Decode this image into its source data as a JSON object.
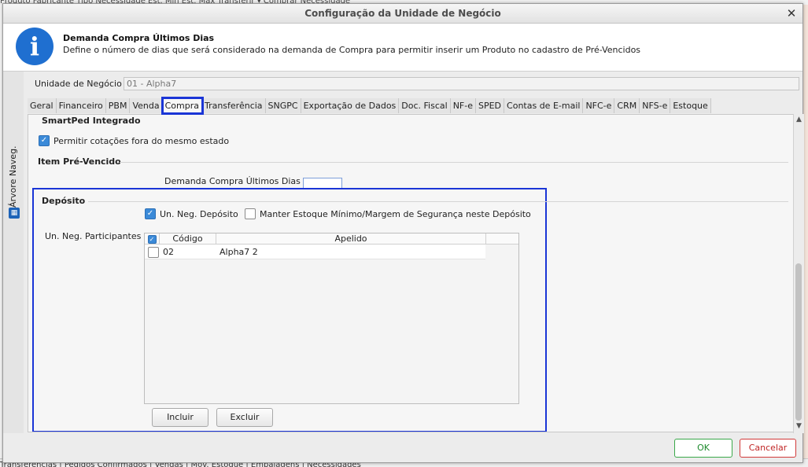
{
  "background": {
    "top_headers": "Produto            Fabricante           Tipo Necessidade            Est. Mín    Est. Máx    Transferir ▾    Comprar    Necessidade",
    "bottom_tabs": "Transferências | Pedidos Confirmados | Vendas | Mov. Estoque | Embalagens | Necessidades"
  },
  "dialog": {
    "title": "Configuração da Unidade de Negócio",
    "close_glyph": "✕"
  },
  "info": {
    "icon_glyph": "i",
    "title": "Demanda Compra Últimos Dias",
    "description": "Define o número de dias que será considerado na demanda de Compra para permitir inserir um Produto no cadastro de Pré-Vencidos"
  },
  "sidebar": {
    "label": "Árvore Naveg."
  },
  "unidade": {
    "label": "Unidade de Negócio",
    "value": "01 - Alpha7"
  },
  "tabs": [
    {
      "label": "Geral"
    },
    {
      "label": "Financeiro"
    },
    {
      "label": "PBM"
    },
    {
      "label": "Venda"
    },
    {
      "label": "Compra"
    },
    {
      "label": "Transferência"
    },
    {
      "label": "SNGPC"
    },
    {
      "label": "Exportação de Dados"
    },
    {
      "label": "Doc. Fiscal"
    },
    {
      "label": "NF-e"
    },
    {
      "label": "SPED"
    },
    {
      "label": "Contas de E-mail"
    },
    {
      "label": "NFC-e"
    },
    {
      "label": "CRM"
    },
    {
      "label": "NFS-e"
    },
    {
      "label": "Estoque"
    }
  ],
  "active_tab": "Compra",
  "compra": {
    "smartped_title": "SmartPed Integrado",
    "permitir_label": "Permitir cotações fora do mesmo estado",
    "item_pre_vencido_title": "Item Pré-Vencido",
    "demanda_label": "Demanda Compra Últimos Dias",
    "demanda_value": "",
    "deposito": {
      "title": "Depósito",
      "un_neg_deposito_label": "Un. Neg. Depósito",
      "un_neg_deposito_checked": true,
      "manter_estoque_label": "Manter Estoque Mínimo/Margem de Segurança neste Depósito",
      "manter_estoque_checked": false,
      "participantes_label": "Un. Neg. Participantes",
      "grid": {
        "columns": [
          "Código",
          "Apelido"
        ],
        "rows": [
          {
            "codigo": "02",
            "apelido": "Alpha7 2",
            "checked": false
          }
        ]
      },
      "incluir_label": "Incluir",
      "excluir_label": "Excluir"
    }
  },
  "footer": {
    "ok_label": "OK",
    "cancel_label": "Cancelar"
  },
  "colors": {
    "highlight": "#1a35d6",
    "info_icon": "#1f6fd0",
    "ok": "#3aa84a",
    "cancel": "#d13a3a"
  }
}
